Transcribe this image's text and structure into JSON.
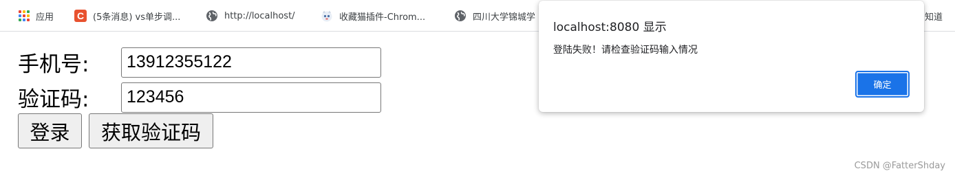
{
  "bookmarks": {
    "items": [
      {
        "label": "应用",
        "icon": "apps-icon"
      },
      {
        "label": "(5条消息) vs单步调...",
        "icon": "csdn-icon",
        "icon_text": "C"
      },
      {
        "label": "http://localhost/",
        "icon": "globe-icon"
      },
      {
        "label": "收藏猫插件-Chrom...",
        "icon": "cat-icon"
      },
      {
        "label": "四川大学锦城学",
        "icon": "globe-icon"
      }
    ],
    "overflow_text": "知道"
  },
  "form": {
    "phone_label": "手机号:",
    "phone_value": "13912355122",
    "code_label": "验证码:",
    "code_value": "123456",
    "login_button": "登录",
    "get_code_button": "获取验证码"
  },
  "dialog": {
    "title": "localhost:8080 显示",
    "message": "登陆失败！请检查验证码输入情况",
    "ok_label": "确定"
  },
  "watermark": "CSDN @FatterShday",
  "colors": {
    "accent": "#1a73e8",
    "csdn_red": "#e8522f",
    "apps_dots": [
      "#ea4335",
      "#fbbc05",
      "#34a853",
      "#4285f4",
      "#ea4335",
      "#fbbc05",
      "#34a853",
      "#4285f4",
      "#ea4335"
    ]
  }
}
